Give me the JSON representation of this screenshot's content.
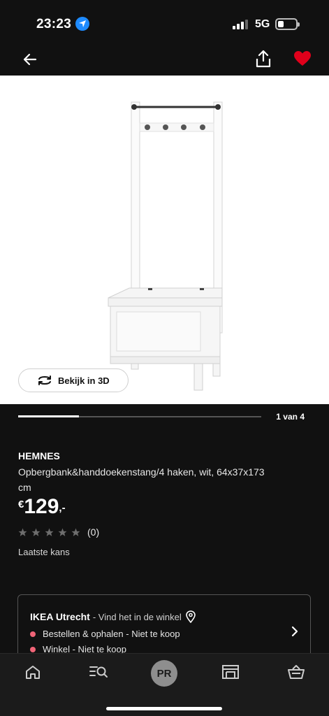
{
  "status_bar": {
    "time": "23:23",
    "network": "5G"
  },
  "app_bar": {
    "back_icon": "arrow-left",
    "share_icon": "share-upload",
    "favorite_icon": "heart-filled",
    "favorite_color": "#e0001b"
  },
  "gallery": {
    "view_3d_label": "Bekijk in 3D",
    "counter": "1 van 4",
    "progress_fraction": 0.25
  },
  "product": {
    "name": "HEMNES",
    "description": "Opbergbank&handdoekenstang/4 haken, wit, 64x37x173 cm",
    "price_currency": "€",
    "price_amount": "129",
    "price_cents": ",-",
    "rating_stars": 0,
    "rating_max": 5,
    "review_count": "(0)",
    "availability_note": "Laatste kans"
  },
  "store": {
    "name": "IKEA Utrecht",
    "subtitle": "- Vind het in de winkel",
    "lines": [
      "Bestellen & ophalen - Niet te koop",
      "Winkel - Niet te koop"
    ],
    "status_color": "#f06477"
  },
  "bottom_nav": {
    "items": [
      "home-icon",
      "search-list-icon",
      "profile-avatar",
      "store-icon",
      "basket-icon"
    ],
    "avatar_initials": "PR"
  }
}
